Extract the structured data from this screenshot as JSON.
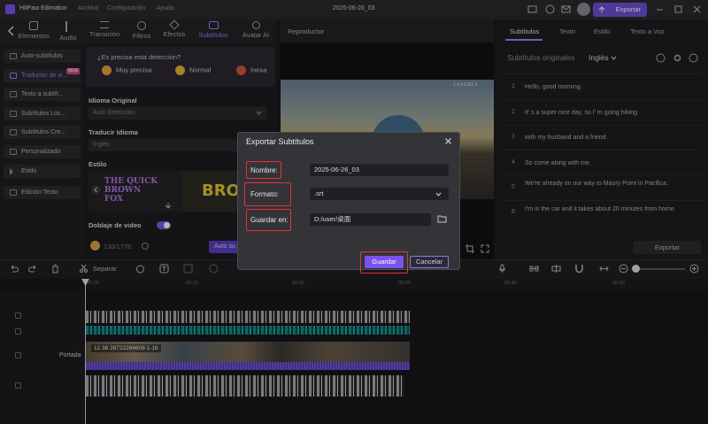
{
  "app": {
    "name": "HitPaw Edimakor",
    "menu": [
      "Archivo",
      "Configuración",
      "Ayuda"
    ],
    "project_title": "2025-06-26_03",
    "export_label": "Exportar"
  },
  "tabs": [
    {
      "label": "Elementos",
      "icon": "elements-icon"
    },
    {
      "label": "Audio",
      "icon": "music-icon"
    },
    {
      "label": "Transición",
      "icon": "transition-icon"
    },
    {
      "label": "Filtros",
      "icon": "filter-icon"
    },
    {
      "label": "Efectos",
      "icon": "effects-icon"
    },
    {
      "label": "Subtítulos",
      "icon": "subtitles-icon",
      "active": true
    },
    {
      "label": "Avatar AI",
      "icon": "avatar-icon"
    }
  ],
  "sidebar": {
    "items": [
      {
        "label": "Auto-subtítulos"
      },
      {
        "label": "Traductor de vi...",
        "active": true
      },
      {
        "label": "Texto a subtít..."
      },
      {
        "label": "Subtítulos Loc..."
      },
      {
        "label": "Subtítulos Cre..."
      },
      {
        "label": "Personalizado"
      },
      {
        "label": "Estilo"
      },
      {
        "label": "Edición Texto"
      }
    ],
    "new_badge": "NEW"
  },
  "settings": {
    "precision_question": "¿Es precisa esta detección?",
    "precision_options": [
      "Muy precisa",
      "Normal",
      "Inexa"
    ],
    "idioma_original_label": "Idioma Original",
    "idioma_original_value": "Auto Detección",
    "traducir_label": "Traducir Idioma",
    "traducir_value": "Inglés",
    "estilo_label": "Estilo",
    "style1_text": "THE QUICK BROWN FOX",
    "style2_text": "BROW",
    "doblaje_label": "Doblaje de video",
    "credits": "130/1776",
    "auto_button": "Auto su"
  },
  "player": {
    "label": "Reproductor",
    "watermark": "1 4 3 ESO 3"
  },
  "right_panel": {
    "tabs": [
      "Subtítulos",
      "Texto",
      "Estilo",
      "Texto a Voz"
    ],
    "original_label": "Subtítulos originales",
    "language": "Inglés",
    "subtitles": [
      {
        "num": "1",
        "text": "Hello, good morning."
      },
      {
        "num": "2",
        "text": "It' s a super nice day, so I' m going hiking"
      },
      {
        "num": "3",
        "text": "with my husband and a friend."
      },
      {
        "num": "4",
        "text": "So come along with me."
      },
      {
        "num": "5",
        "text": "We're already on our way to Maury Point in Pacifica."
      },
      {
        "num": "6",
        "text": "I'm in the car and it takes about 20 minutes from home."
      }
    ],
    "export_label": "Exportar"
  },
  "toolbar": {
    "separar": "Separar"
  },
  "timeline": {
    "ruler": [
      "00:00",
      "00:10",
      "00:20",
      "00:30",
      "00:40",
      "00:50"
    ],
    "track_label": "Portada",
    "clip_label": "12.38 28722266608 1-16"
  },
  "dialog": {
    "title": "Exportar Subtítulos",
    "nombre_label": "Nombre:",
    "nombre_value": "2025-06-26_03",
    "formato_label": "Formato:",
    "formato_value": ".srt",
    "guardar_en_label": "Guardar en:",
    "guardar_en_value": "D:/user/桌面",
    "guardar_button": "Guardar",
    "cancelar_button": "Cancelar"
  },
  "colors": {
    "accent": "#7b52f0",
    "highlight": "#e33636",
    "bg": "#1b1b1e"
  }
}
